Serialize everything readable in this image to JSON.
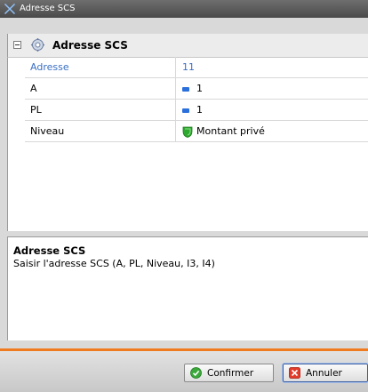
{
  "window": {
    "title": "Adresse SCS"
  },
  "group": {
    "title": "Adresse SCS"
  },
  "properties": [
    {
      "name": "Adresse",
      "value": "11"
    },
    {
      "name": "A",
      "value": "1"
    },
    {
      "name": "PL",
      "value": "1"
    },
    {
      "name": "Niveau",
      "value": "Montant privé"
    }
  ],
  "description": {
    "title": "Adresse SCS",
    "text": "Saisir l'adresse SCS (A, PL, Niveau, I3, I4)"
  },
  "buttons": {
    "confirm": "Confirmer",
    "cancel": "Annuler"
  },
  "colors": {
    "accent": "#f07a20",
    "selected_text": "#3a6fc4",
    "chip": "#2a6fdc",
    "shield": "#2ea82e"
  }
}
